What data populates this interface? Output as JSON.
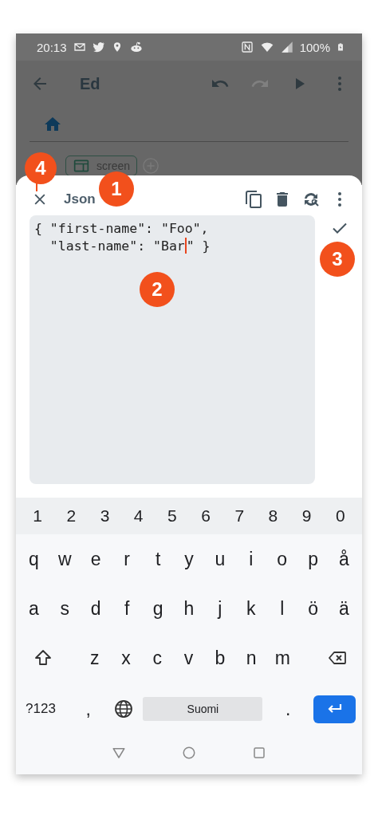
{
  "status_bar": {
    "time": "20:13",
    "battery": "100%"
  },
  "app_bar": {
    "title": "Ed",
    "actions": [
      {
        "kind": "undo",
        "disabled": false
      },
      {
        "kind": "redo",
        "disabled": true
      },
      {
        "kind": "play",
        "disabled": false
      }
    ]
  },
  "chips": [
    {
      "label": "screen"
    }
  ],
  "sheet": {
    "title": "Json",
    "editor": {
      "text_before_cursor": "{ \"first-name\": \"Foo\",\n  \"last-name\": \"Bar",
      "text_after_cursor": "\" }"
    }
  },
  "keyboard": {
    "number_row": [
      "1",
      "2",
      "3",
      "4",
      "5",
      "6",
      "7",
      "8",
      "9",
      "0"
    ],
    "letter_rows": [
      [
        "q",
        "w",
        "e",
        "r",
        "t",
        "y",
        "u",
        "i",
        "o",
        "p",
        "å"
      ],
      [
        "a",
        "s",
        "d",
        "f",
        "g",
        "h",
        "j",
        "k",
        "l",
        "ö",
        "ä"
      ],
      [
        "z",
        "x",
        "c",
        "v",
        "b",
        "n",
        "m"
      ]
    ],
    "symbols_key": "?123",
    "comma_key": ",",
    "space_key": "Suomi",
    "period_key": "."
  },
  "callouts": [
    {
      "label": "4"
    },
    {
      "label": "1"
    },
    {
      "label": "3"
    },
    {
      "label": "2"
    }
  ]
}
